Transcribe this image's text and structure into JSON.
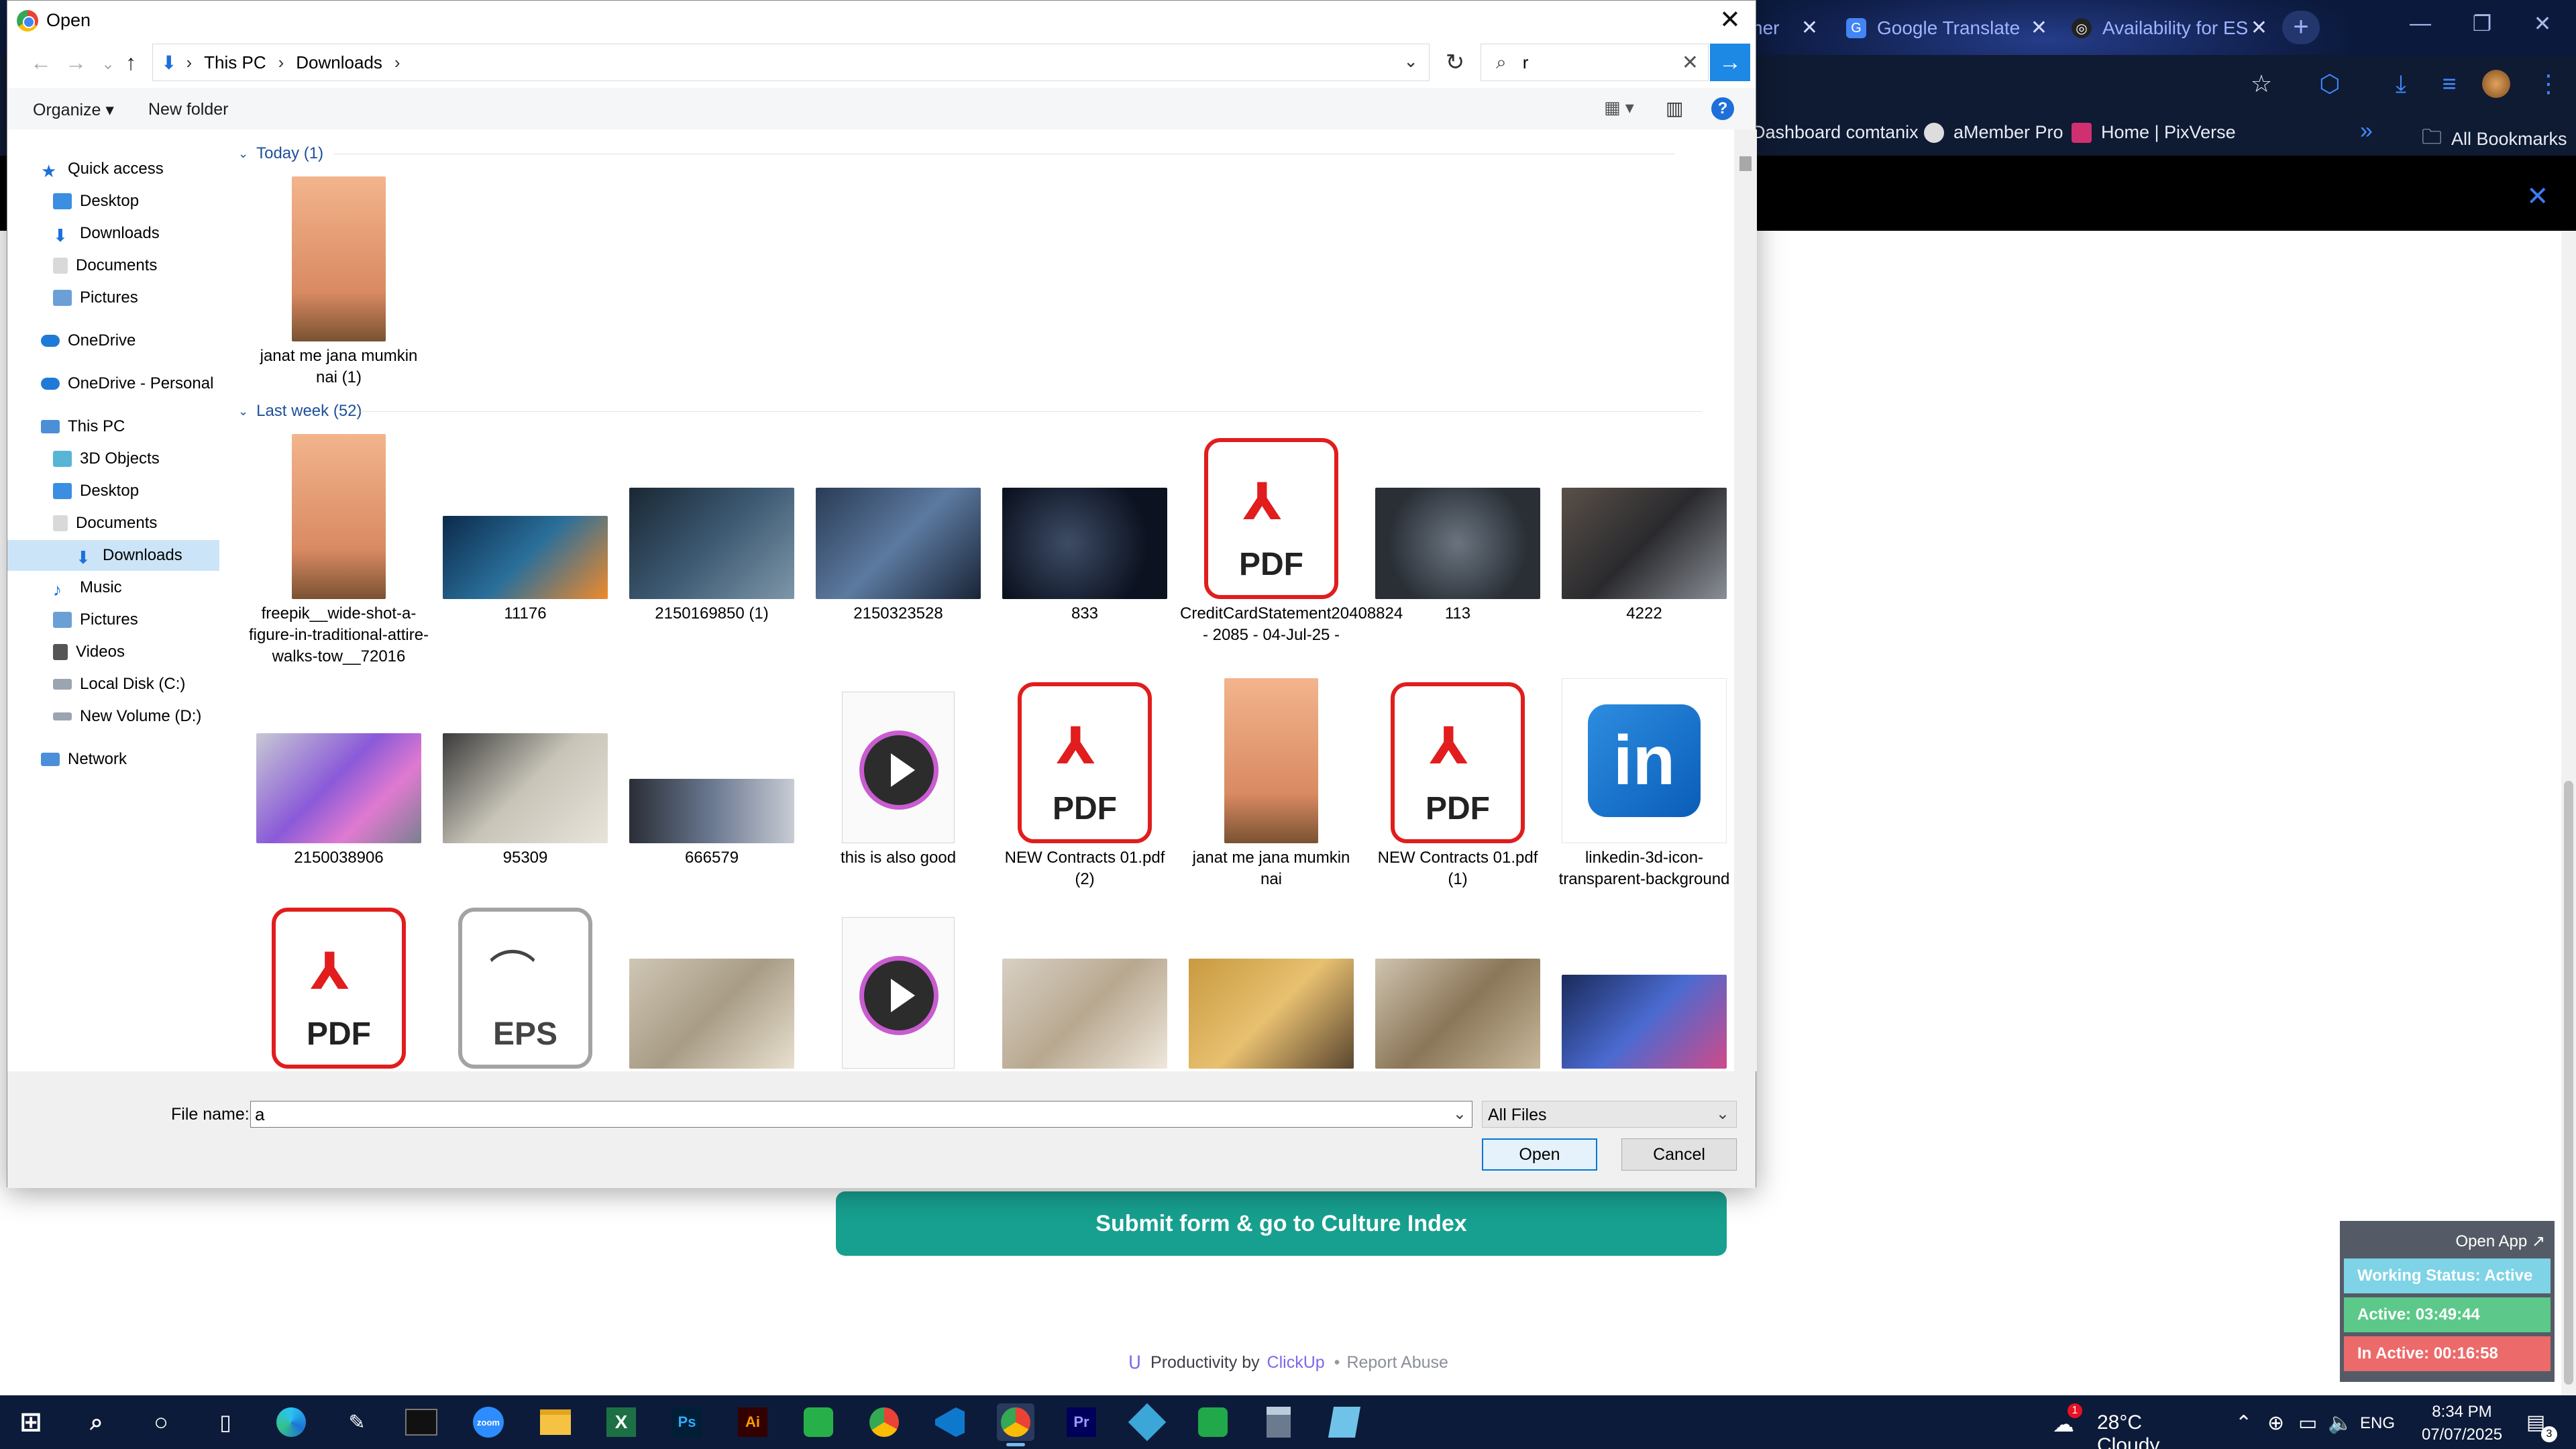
{
  "browser": {
    "tabs": [
      {
        "label": "ner",
        "icon": "tab-partial-icon"
      },
      {
        "label": "Google Translate",
        "icon": "google-translate-icon"
      },
      {
        "label": "Availability for ES",
        "icon": "availability-icon"
      }
    ],
    "bookmarks": [
      "Dashboard comtanix",
      "aMember Pro",
      "Home | PixVerse"
    ],
    "all_bookmarks": "All Bookmarks",
    "overflow": "»"
  },
  "page": {
    "submit_label": "Submit form & go to Culture Index",
    "footer_prefix": "Productivity by",
    "footer_brand": "ClickUp",
    "footer_sep": "•",
    "footer_report": "Report Abuse"
  },
  "widget": {
    "open_app": "Open App ↗",
    "working_status": "Working Status: Active",
    "active": "Active: 03:49:44",
    "inactive": "In Active: 00:16:58",
    "colors": {
      "working": "#7fd3e6",
      "active": "#5cc98a",
      "inactive": "#ec6a6a"
    }
  },
  "dialog": {
    "title": "Open",
    "breadcrumb": [
      "This PC",
      "Downloads"
    ],
    "search_value": "r",
    "organize": "Organize ▾",
    "new_folder": "New folder",
    "nav": {
      "quick_access": "Quick access",
      "qa_items": [
        "Desktop",
        "Downloads",
        "Documents",
        "Pictures"
      ],
      "onedrive": "OneDrive",
      "onedrive_personal": "OneDrive - Personal",
      "this_pc": "This PC",
      "pc_items": [
        "3D Objects",
        "Desktop",
        "Documents",
        "Downloads",
        "Music",
        "Pictures",
        "Videos",
        "Local Disk (C:)",
        "New Volume (D:)"
      ],
      "network": "Network"
    },
    "groups": {
      "today": "Today (1)",
      "last_week": "Last week (52)"
    },
    "files_today": [
      {
        "name": "janat me jana mumkin nai (1)",
        "kind": "poster"
      }
    ],
    "files_row1": [
      {
        "name": "freepik__wide-shot-a-figure-in-traditional-attire-walks-tow__72016",
        "kind": "poster"
      },
      {
        "name": "11176",
        "kind": "photo"
      },
      {
        "name": "2150169850 (1)",
        "kind": "photo"
      },
      {
        "name": "2150323528",
        "kind": "photo"
      },
      {
        "name": "833",
        "kind": "photo"
      },
      {
        "name": "CreditCardStatement20408824 - 2085 - 04-Jul-25 -",
        "kind": "pdf"
      },
      {
        "name": "113",
        "kind": "photo"
      },
      {
        "name": "4222",
        "kind": "photo"
      }
    ],
    "files_row2": [
      {
        "name": "2150038906",
        "kind": "photo"
      },
      {
        "name": "95309",
        "kind": "photo"
      },
      {
        "name": "666579",
        "kind": "photo"
      },
      {
        "name": "this is also good",
        "kind": "video"
      },
      {
        "name": "NEW Contracts 01.pdf (2)",
        "kind": "pdf"
      },
      {
        "name": "janat me jana mumkin nai",
        "kind": "poster"
      },
      {
        "name": "NEW Contracts 01.pdf (1)",
        "kind": "pdf"
      },
      {
        "name": "linkedin-3d-icon-transparent-background",
        "kind": "linkedin"
      }
    ],
    "files_row3": [
      {
        "name": "",
        "kind": "pdf"
      },
      {
        "name": "",
        "kind": "eps"
      },
      {
        "name": "",
        "kind": "photo"
      },
      {
        "name": "",
        "kind": "video"
      },
      {
        "name": "",
        "kind": "photo"
      },
      {
        "name": "",
        "kind": "photo"
      },
      {
        "name": "",
        "kind": "photo"
      },
      {
        "name": "",
        "kind": "photo"
      }
    ],
    "pdf_text": "PDF",
    "eps_text": "EPS",
    "filename_label": "File name:",
    "filename_value": "a",
    "filetype_value": "All Files",
    "open_label": "Open",
    "cancel_label": "Cancel"
  },
  "taskbar": {
    "weather": "28°C  Cloudy",
    "weather_badge": "1",
    "lang": "ENG",
    "time": "8:34 PM",
    "date": "07/07/2025",
    "notif_count": "3",
    "apps": [
      "start-icon",
      "search-icon",
      "cortana-icon",
      "task-view-icon",
      "edge-icon",
      "pen-icon",
      "terminal-icon",
      "zoom-icon",
      "file-explorer-icon",
      "excel-icon",
      "photoshop-icon",
      "illustrator-icon",
      "green-app-icon",
      "chrome-icon",
      "vscode-icon",
      "chrome-active-icon",
      "premiere-icon",
      "blue-app-icon",
      "green-app-2-icon",
      "calculator-icon",
      "notepad-icon"
    ]
  }
}
